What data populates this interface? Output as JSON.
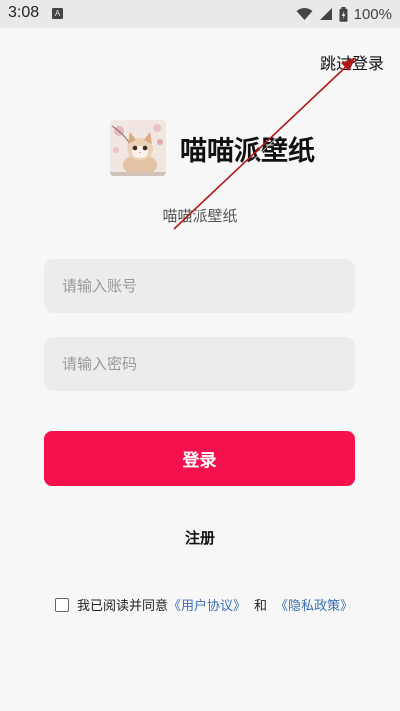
{
  "status_bar": {
    "time": "3:08",
    "notification_icon": "A",
    "battery_percent": "100%"
  },
  "header": {
    "skip_login_label": "跳过登录"
  },
  "branding": {
    "app_name": "喵喵派壁纸",
    "subtitle": "喵喵派壁纸",
    "logo_icon": "cat-photo"
  },
  "form": {
    "account_placeholder": "请输入账号",
    "account_value": "",
    "password_placeholder": "请输入密码",
    "password_value": "",
    "login_label": "登录",
    "register_label": "注册"
  },
  "agreement": {
    "text_before": "我已阅读并同意",
    "user_agreement_label": "《用户协议》",
    "and_text": "和",
    "privacy_policy_label": "《隐私政策》",
    "checked": false
  },
  "colors": {
    "primary": "#f5114e",
    "link": "#3b6fb6",
    "background": "#f7f7f7",
    "annotation_arrow": "#b01818"
  }
}
